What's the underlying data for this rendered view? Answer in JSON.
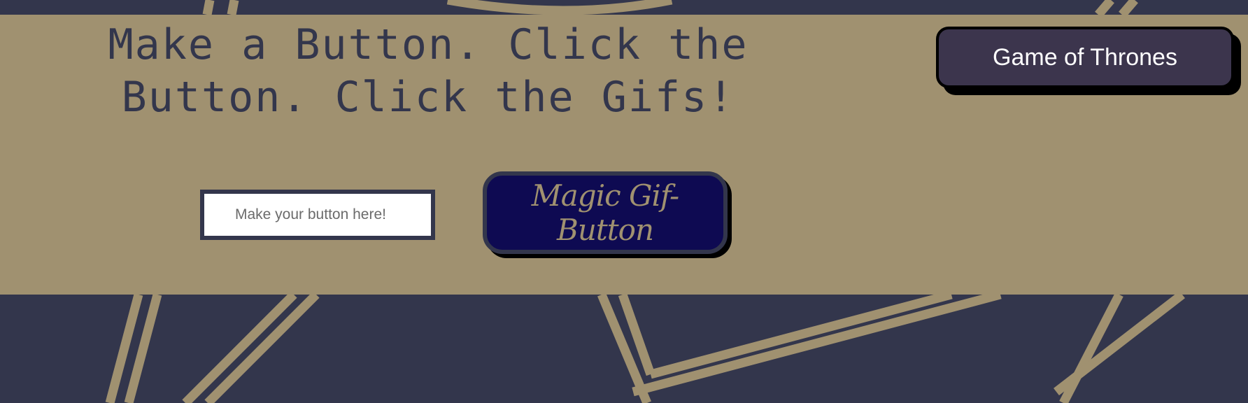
{
  "page": {
    "headline": "Make a Button. Click the Button. Click the Gifs!"
  },
  "topic_buttons": [
    {
      "label": "Game of Thrones"
    }
  ],
  "form": {
    "input_placeholder": "Make your button here!",
    "input_value": "",
    "submit_label": "Magic Gif-Button"
  },
  "colors": {
    "background": "#33364c",
    "pattern_gold": "#a09170",
    "panel": "#a09170",
    "headline_text": "#33364c",
    "submit_button_bg": "#0e0a52",
    "submit_button_text": "#a09170",
    "topic_button_bg": "#3c354d",
    "topic_button_text": "#ffffff",
    "shadow": "#000000"
  }
}
